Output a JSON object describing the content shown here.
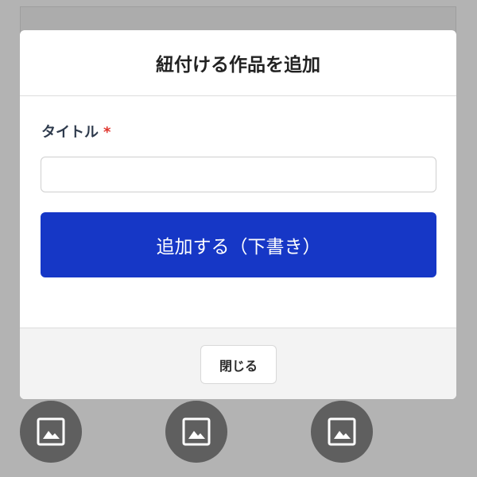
{
  "modal": {
    "title": "紐付ける作品を追加",
    "field": {
      "label": "タイトル",
      "required_mark": "*",
      "value": "",
      "placeholder": ""
    },
    "submit_label": "追加する（下書き）",
    "close_label": "閉じる"
  },
  "thumbnails": [
    {
      "icon": "image-placeholder-icon"
    },
    {
      "icon": "image-placeholder-icon"
    },
    {
      "icon": "image-placeholder-icon"
    }
  ],
  "colors": {
    "backdrop": "#b3b3b3",
    "primary_button": "#1637c6",
    "required": "#e0342c",
    "label_text": "#2f3b4d",
    "footer_bg": "#f3f3f3"
  }
}
